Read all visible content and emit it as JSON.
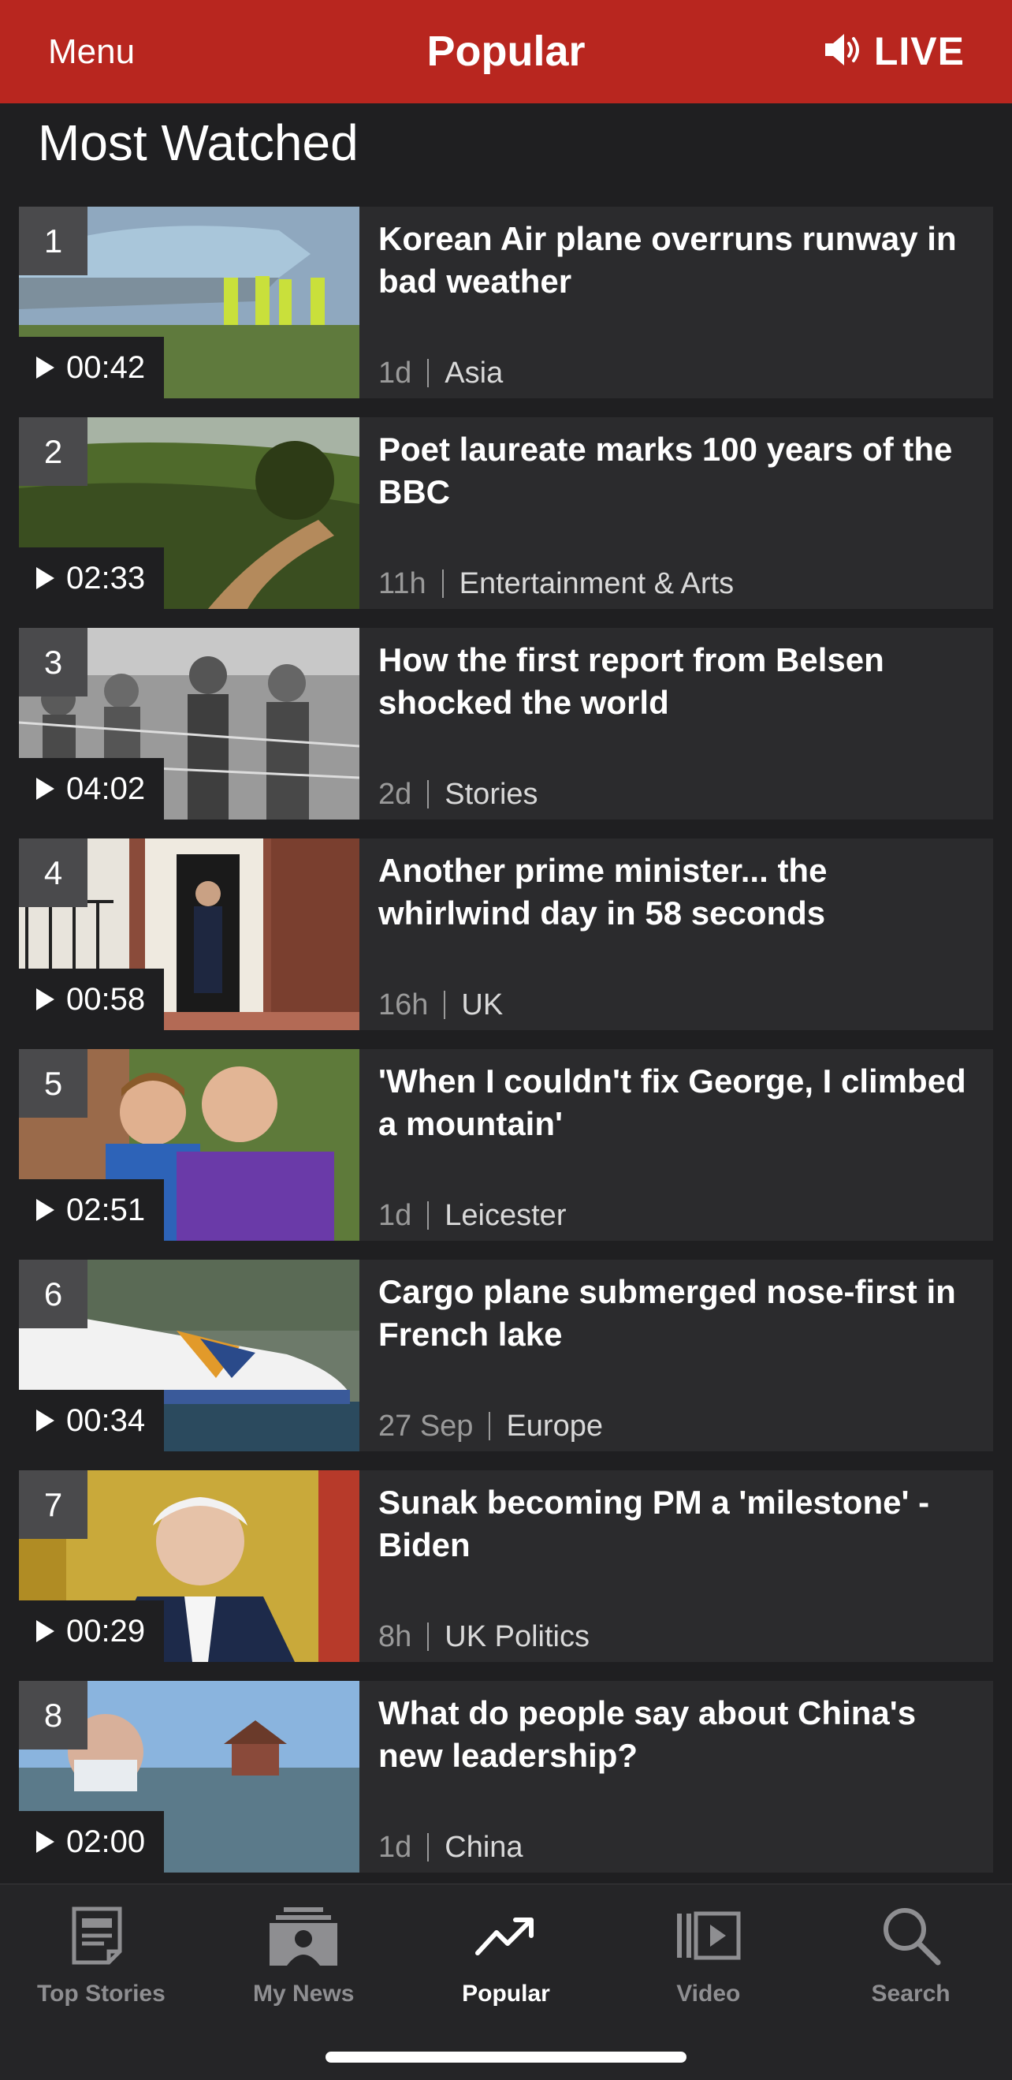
{
  "header": {
    "menu_label": "Menu",
    "title": "Popular",
    "live_label": "LIVE",
    "live_icon": "speaker-icon",
    "background_color": "#b8261f"
  },
  "section": {
    "heading": "Most Watched"
  },
  "items": [
    {
      "rank": "1",
      "duration": "00:42",
      "title": "Korean Air plane overruns runway in bad weather",
      "age": "1d",
      "category": "Asia"
    },
    {
      "rank": "2",
      "duration": "02:33",
      "title": "Poet laureate marks 100 years of the BBC",
      "age": "11h",
      "category": "Entertainment & Arts"
    },
    {
      "rank": "3",
      "duration": "04:02",
      "title": "How the first report from Belsen shocked the world",
      "age": "2d",
      "category": "Stories"
    },
    {
      "rank": "4",
      "duration": "00:58",
      "title": "Another prime minister... the whirlwind day in 58 seconds",
      "age": "16h",
      "category": "UK"
    },
    {
      "rank": "5",
      "duration": "02:51",
      "title": "'When I couldn't fix George, I climbed a mountain'",
      "age": "1d",
      "category": "Leicester"
    },
    {
      "rank": "6",
      "duration": "00:34",
      "title": "Cargo plane submerged nose-first in French lake",
      "age": "27 Sep",
      "category": "Europe"
    },
    {
      "rank": "7",
      "duration": "00:29",
      "title": "Sunak becoming PM a 'milestone' - Biden",
      "age": "8h",
      "category": "UK Politics"
    },
    {
      "rank": "8",
      "duration": "02:00",
      "title": "What do people say about China's new leadership?",
      "age": "1d",
      "category": "China"
    }
  ],
  "tabbar": {
    "tabs": [
      {
        "label": "Top Stories",
        "icon": "newspaper-icon",
        "active": false
      },
      {
        "label": "My News",
        "icon": "person-news-icon",
        "active": false
      },
      {
        "label": "Popular",
        "icon": "trending-icon",
        "active": true
      },
      {
        "label": "Video",
        "icon": "video-library-icon",
        "active": false
      },
      {
        "label": "Search",
        "icon": "search-icon",
        "active": false
      }
    ]
  }
}
